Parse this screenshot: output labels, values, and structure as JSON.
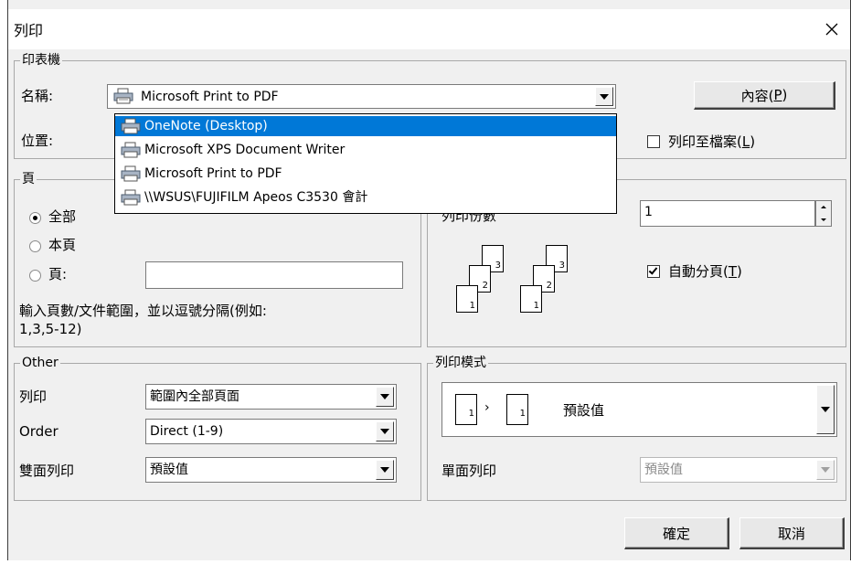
{
  "window": {
    "title": "列印"
  },
  "printer_group": {
    "legend": "印表機",
    "name_label": "名稱:",
    "location_label": "位置:",
    "selected_printer": "Microsoft Print to PDF",
    "properties_button": "內容(",
    "properties_accel": "P",
    "print_to_file_label": "列印至檔案(",
    "print_to_file_accel": "L",
    "print_to_file_checked": false
  },
  "printer_dropdown": {
    "items": [
      {
        "label": "OneNote (Desktop)",
        "selected": true
      },
      {
        "label": "Microsoft XPS Document Writer",
        "selected": false
      },
      {
        "label": "Microsoft Print to PDF",
        "selected": false
      },
      {
        "label": "\\\\WSUS\\FUJIFILM Apeos C3530 會計",
        "selected": false
      }
    ]
  },
  "page_group": {
    "legend": "頁",
    "all_label": "全部",
    "current_label": "本頁",
    "pages_label": "頁:",
    "pages_value": "",
    "selected_option": "全部",
    "hint_line1": "輸入頁數/文件範圍，並以逗號分隔(例如:",
    "hint_line2": "1,3,5-12)"
  },
  "copies_group": {
    "copies_label": "列印份數",
    "copies_value": "1",
    "collate_label": "自動分頁(",
    "collate_accel": "T",
    "collate_checked": true,
    "collate_pages": [
      "1",
      "2",
      "3"
    ]
  },
  "other_group": {
    "legend": "Other",
    "print_label": "列印",
    "print_value": "範圍內全部頁面",
    "order_label": "Order",
    "order_value": "Direct (1-9)",
    "duplex_label": "雙面列印",
    "duplex_value": "預設值"
  },
  "mode_group": {
    "legend": "列印模式",
    "mode_value": "預設值",
    "mode_pages": [
      "1",
      "1"
    ],
    "single_side_label": "單面列印",
    "single_side_value": "預設值"
  },
  "footer": {
    "ok_button": "確定",
    "cancel_button": "取消"
  },
  "icons": {
    "printer": "printer-icon",
    "close": "close-icon",
    "dropdown": "chevron-down-icon"
  }
}
